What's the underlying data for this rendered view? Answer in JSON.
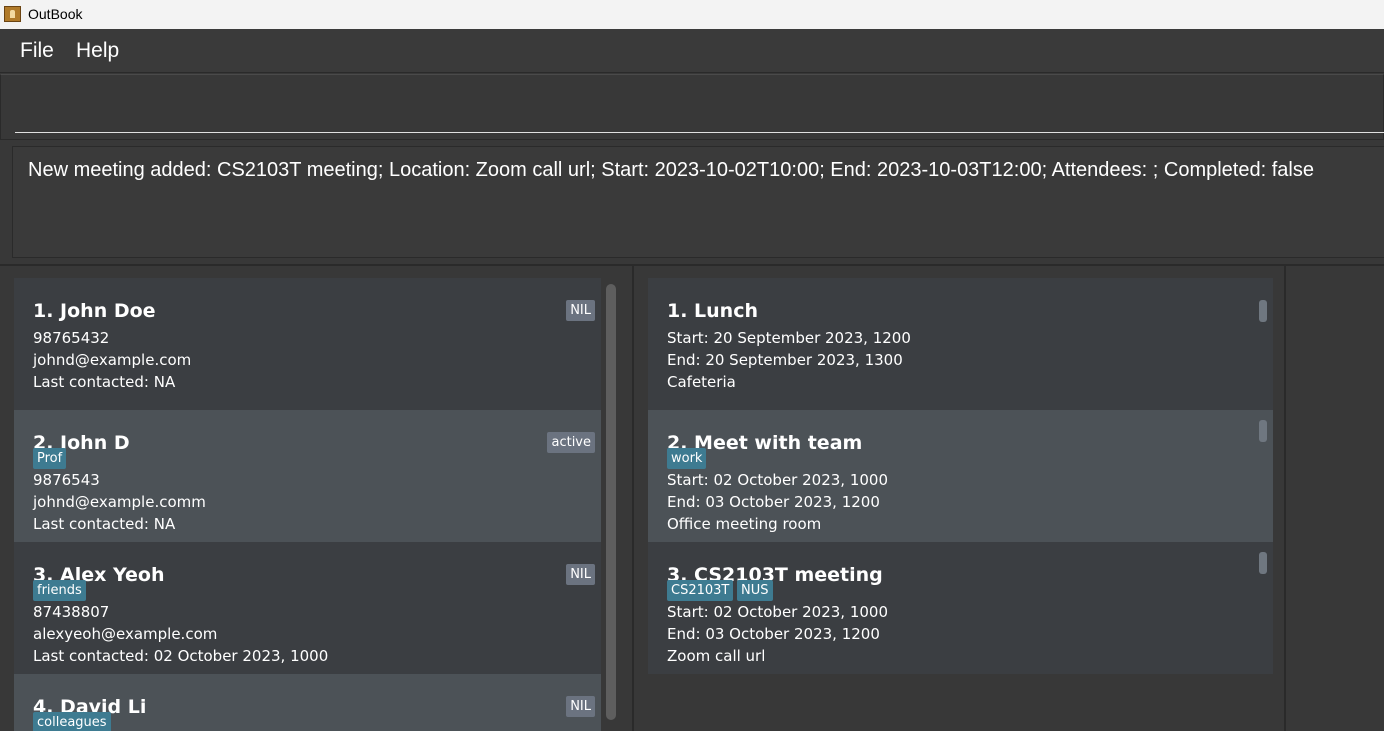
{
  "window": {
    "title": "OutBook"
  },
  "menu": {
    "file": "File",
    "help": "Help"
  },
  "command": {
    "value": "",
    "placeholder": ""
  },
  "result": {
    "message": "New meeting added: CS2103T meeting; Location: Zoom call url; Start: 2023-10-02T10:00; End: 2023-10-03T12:00; Attendees: ; Completed: false"
  },
  "persons": [
    {
      "name": "1.  John Doe",
      "status": "NIL",
      "tags": [],
      "phone": "98765432",
      "email": "johnd@example.com",
      "last_contacted": "Last contacted: NA"
    },
    {
      "name": "2.  John D",
      "status": "active",
      "tags": [
        "Prof"
      ],
      "phone": "9876543",
      "email": "johnd@example.comm",
      "last_contacted": "Last contacted: NA"
    },
    {
      "name": "3.  Alex Yeoh",
      "status": "NIL",
      "tags": [
        "friends"
      ],
      "phone": "87438807",
      "email": "alexyeoh@example.com",
      "last_contacted": "Last contacted: 02 October 2023, 1000"
    },
    {
      "name": "4.  David Li",
      "status": "NIL",
      "tags": [
        "colleagues"
      ]
    }
  ],
  "meetings": [
    {
      "title": "1.  Lunch",
      "tags": [],
      "start": "Start: 20 September 2023, 1200",
      "end": "End: 20 September 2023, 1300",
      "location": "Cafeteria"
    },
    {
      "title": "2.  Meet with team",
      "tags": [
        "work"
      ],
      "start": "Start: 02 October 2023, 1000",
      "end": "End: 03 October 2023, 1200",
      "location": "Office meeting room"
    },
    {
      "title": "3.  CS2103T meeting",
      "tags": [
        "CS2103T",
        "NUS"
      ],
      "start": "Start: 02 October 2023, 1000",
      "end": "End: 03 October 2023, 1200",
      "location": "Zoom call url"
    }
  ],
  "colors": {
    "tag": "#3e7b91",
    "status": "#6b7380",
    "card_dark": "#3b3e42",
    "card_light": "#4c5257",
    "background": "#383838"
  }
}
